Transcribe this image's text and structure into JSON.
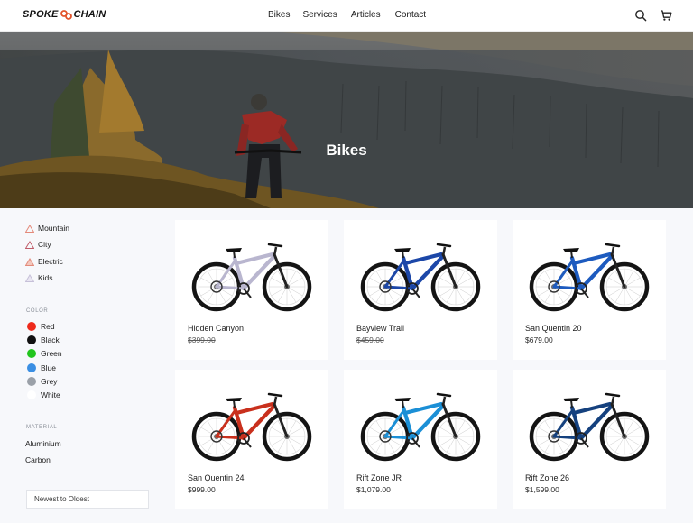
{
  "brand": {
    "name_left": "SPOKE",
    "name_right": "CHAIN",
    "accent": "#e2532a"
  },
  "nav": {
    "items": [
      "Bikes",
      "Services",
      "Articles",
      "Contact"
    ]
  },
  "header_icons": {
    "search": "search-icon",
    "cart": "cart-icon"
  },
  "hero": {
    "title": "Bikes"
  },
  "filters": {
    "categories": [
      {
        "label": "Mountain",
        "icon": "mountain-icon"
      },
      {
        "label": "City",
        "icon": "city-icon"
      },
      {
        "label": "Electric",
        "icon": "electric-icon"
      },
      {
        "label": "Kids",
        "icon": "kids-icon"
      }
    ],
    "color_label": "COLOR",
    "colors": [
      {
        "label": "Red",
        "hex": "#ee2a1b"
      },
      {
        "label": "Black",
        "hex": "#111111"
      },
      {
        "label": "Green",
        "hex": "#22c51d"
      },
      {
        "label": "Blue",
        "hex": "#3b8fe3"
      },
      {
        "label": "Grey",
        "hex": "#9aa0a8"
      },
      {
        "label": "White",
        "hex": "#ffffff"
      }
    ],
    "material_label": "MATERIAL",
    "materials": [
      "Aluminium",
      "Carbon"
    ],
    "sort": {
      "value": "Newest to Oldest"
    }
  },
  "products": [
    {
      "name": "Hidden Canyon",
      "price": "$399.00",
      "struck": true,
      "frame_color": "#b9b6cf"
    },
    {
      "name": "Bayview Trail",
      "price": "$459.00",
      "struck": true,
      "frame_color": "#1c47a8"
    },
    {
      "name": "San Quentin 20",
      "price": "$679.00",
      "struck": false,
      "frame_color": "#1d5bbf"
    },
    {
      "name": "San Quentin 24",
      "price": "$999.00",
      "struck": false,
      "frame_color": "#c9301d"
    },
    {
      "name": "Rift Zone JR",
      "price": "$1,079.00",
      "struck": false,
      "frame_color": "#1b8fd6"
    },
    {
      "name": "Rift Zone 26",
      "price": "$1,599.00",
      "struck": false,
      "frame_color": "#15417e"
    }
  ]
}
